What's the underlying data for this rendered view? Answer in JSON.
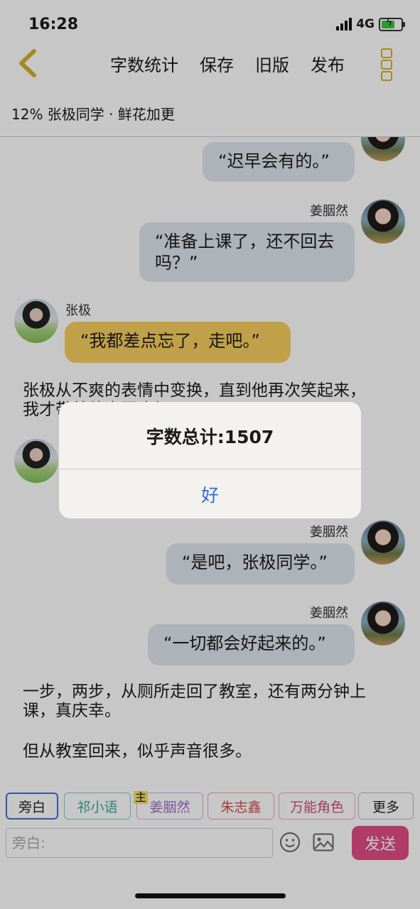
{
  "status_bar": {
    "time": "16:28",
    "network": "4G"
  },
  "nav": {
    "items": [
      "字数统计",
      "保存",
      "旧版",
      "发布"
    ]
  },
  "subtitle": "12% 张极同学 · 鲜花加更",
  "chat": {
    "msg1": {
      "text": "“迟早会有的。”"
    },
    "msg2": {
      "speaker": "姜胭然",
      "text": "“准备上课了，还不回去吗？”"
    },
    "msg3": {
      "speaker": "张极",
      "text": "“我都差点忘了，走吧。”"
    },
    "narration1": "张极从不爽的表情中变换，直到他再次笑起来，我才带着他走回班级。",
    "msg5": {
      "speaker": "姜胭然",
      "text": "“是吧，张极同学。”"
    },
    "msg6": {
      "speaker": "姜胭然",
      "text": "“一切都会好起来的。”"
    },
    "narration2": "一步，两步，从厕所走回了教室，还有两分钟上课，真庆幸。",
    "narration3": "但从教室回来，似乎声音很多。"
  },
  "dialog": {
    "title": "字数总计:1507",
    "confirm": "好"
  },
  "characters": {
    "chips": [
      "旁白",
      "祁小语",
      "姜胭然",
      "朱志鑫",
      "万能角色",
      "更多"
    ],
    "main_badge": "主",
    "colors": [
      "#222222",
      "#3aa7a0",
      "#a070c8",
      "#d94a4a",
      "#d24a7a",
      "#222222"
    ]
  },
  "composer": {
    "placeholder": "旁白:",
    "send_label": "发送"
  },
  "colors": {
    "accent": "#e04c84",
    "bubble_gray": "#dfe4ee",
    "bubble_yellow": "#f6cf5f",
    "link_blue": "#2d6fd6"
  }
}
